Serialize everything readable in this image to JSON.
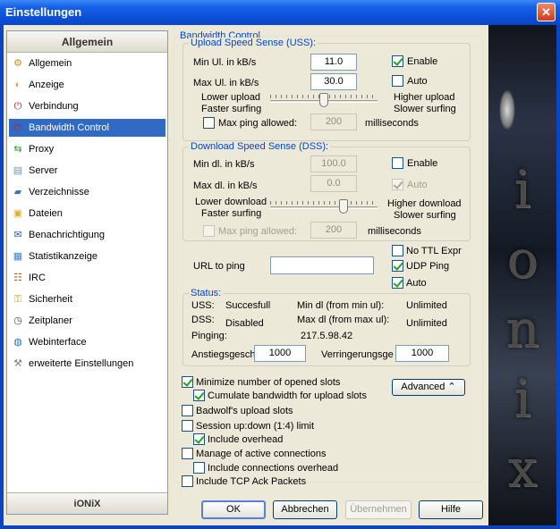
{
  "window": {
    "title": "Einstellungen",
    "close_glyph": "✕"
  },
  "sidebar": {
    "header": "Allgemein",
    "footer": "iONiX",
    "items": [
      {
        "label": "Allgemein",
        "icon": "gear-icon",
        "color": "#d08a20"
      },
      {
        "label": "Anzeige",
        "icon": "palette-icon",
        "color": "#e0a040"
      },
      {
        "label": "Verbindung",
        "icon": "plug-icon",
        "color": "#c02020"
      },
      {
        "label": "Bandwidth Control",
        "icon": "plug-icon",
        "color": "#c02020",
        "selected": true
      },
      {
        "label": "Proxy",
        "icon": "proxy-icon",
        "color": "#30a030"
      },
      {
        "label": "Server",
        "icon": "server-icon",
        "color": "#7090b0"
      },
      {
        "label": "Verzeichnisse",
        "icon": "folder-icon",
        "color": "#4070c0"
      },
      {
        "label": "Dateien",
        "icon": "files-icon",
        "color": "#e0b030"
      },
      {
        "label": "Benachrichtigung",
        "icon": "notification-icon",
        "color": "#3060b0"
      },
      {
        "label": "Statistikanzeige",
        "icon": "statistics-icon",
        "color": "#4080d0"
      },
      {
        "label": "IRC",
        "icon": "irc-icon",
        "color": "#a06030"
      },
      {
        "label": "Sicherheit",
        "icon": "lock-icon",
        "color": "#c0a020"
      },
      {
        "label": "Zeitplaner",
        "icon": "clock-icon",
        "color": "#404040"
      },
      {
        "label": "Webinterface",
        "icon": "globe-icon",
        "color": "#2070d0"
      },
      {
        "label": "erweiterte Einstellungen",
        "icon": "wrench-icon",
        "color": "#808080"
      }
    ]
  },
  "bandwidth": {
    "title": "Bandwidth Control",
    "uss": {
      "title": "Upload Speed Sense (USS):",
      "min_label": "Min Ul. in kB/s",
      "min_value": "11.0",
      "max_label": "Max Ul. in kB/s",
      "max_value": "30.0",
      "enable_label": "Enable",
      "enable_checked": true,
      "auto_label": "Auto",
      "auto_checked": false,
      "left_l1": "Lower upload",
      "left_l2": "Faster surfing",
      "right_l1": "Higher upload",
      "right_l2": "Slower surfing",
      "slider_position": 0.5,
      "ping_label": "Max ping allowed:",
      "ping_value": "200",
      "ping_unit": "milliseconds"
    },
    "dss": {
      "title": "Download Speed Sense (DSS):",
      "min_label": "Min dl. in kB/s",
      "min_value": "100.0",
      "max_label": "Max dl. in kB/s",
      "max_value": "0.0",
      "enable_label": "Enable",
      "enable_checked": false,
      "auto_label": "Auto",
      "auto_checked": true,
      "left_l1": "Lower download",
      "left_l2": "Faster surfing",
      "right_l1": "Higher download",
      "right_l2": "Slower surfing",
      "slider_position": 0.7,
      "ping_label": "Max ping allowed:",
      "ping_value": "200",
      "ping_unit": "milliseconds"
    },
    "ping": {
      "url_label": "URL to ping",
      "url_value": "",
      "no_ttl_label": "No TTL Expr",
      "udp_label": "UDP Ping",
      "auto_label": "Auto"
    },
    "status": {
      "title": "Status:",
      "uss_label": "USS:",
      "uss_value": "Succesfull",
      "dss_label": "DSS:",
      "dss_value": "Disabled",
      "pinging_label": "Pinging:",
      "pinging_value": "217.5.98.42",
      "min_dl_label": "Min dl  (from min ul):",
      "min_dl_value": "Unlimited",
      "max_dl_label": "Max dl  (from max ul):",
      "max_dl_value": "Unlimited",
      "rise_label": "Anstiegsgesch",
      "rise_value": "1000",
      "fall_label": "Verringerungsge",
      "fall_value": "1000"
    },
    "options": {
      "minimize_slots": "Minimize number of opened slots",
      "cumulate": "Cumulate bandwidth for upload slots",
      "badwolf": "Badwolf's upload slots",
      "session_limit": "Session up:down (1:4) limit",
      "include_overhead": "Include overhead",
      "manage_connections": "Manage of active connections",
      "include_conn_overhead": "Include connections overhead",
      "include_tcp_ack": "Include TCP Ack Packets",
      "advanced_button": "Advanced",
      "advanced_glyph": "⌃"
    }
  },
  "buttons": {
    "ok": "OK",
    "cancel": "Abbrechen",
    "apply": "Übernehmen",
    "help": "Hilfe"
  },
  "banner": {
    "letters": [
      "i",
      "o",
      "n",
      "i",
      "x"
    ]
  }
}
